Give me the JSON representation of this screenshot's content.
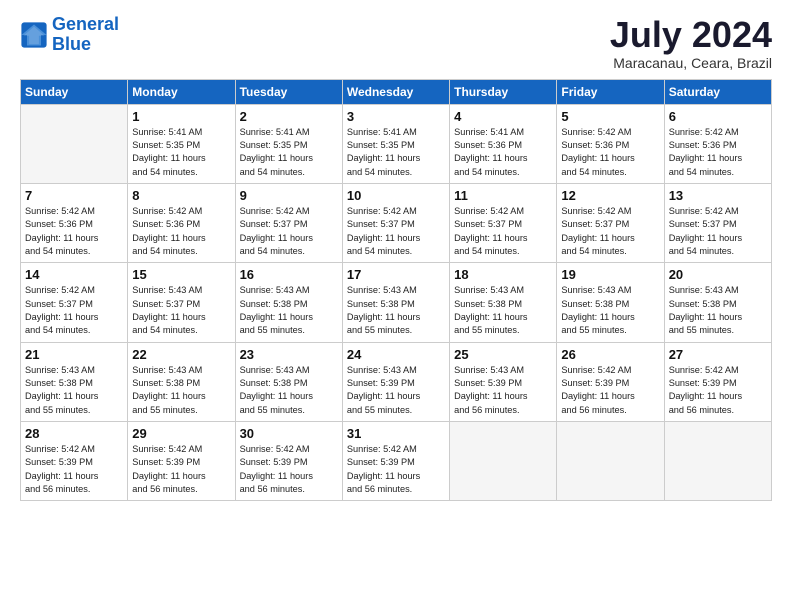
{
  "header": {
    "logo_line1": "General",
    "logo_line2": "Blue",
    "month_year": "July 2024",
    "location": "Maracanau, Ceara, Brazil"
  },
  "weekdays": [
    "Sunday",
    "Monday",
    "Tuesday",
    "Wednesday",
    "Thursday",
    "Friday",
    "Saturday"
  ],
  "weeks": [
    [
      {
        "day": "",
        "info": ""
      },
      {
        "day": "1",
        "info": "Sunrise: 5:41 AM\nSunset: 5:35 PM\nDaylight: 11 hours\nand 54 minutes."
      },
      {
        "day": "2",
        "info": "Sunrise: 5:41 AM\nSunset: 5:35 PM\nDaylight: 11 hours\nand 54 minutes."
      },
      {
        "day": "3",
        "info": "Sunrise: 5:41 AM\nSunset: 5:35 PM\nDaylight: 11 hours\nand 54 minutes."
      },
      {
        "day": "4",
        "info": "Sunrise: 5:41 AM\nSunset: 5:36 PM\nDaylight: 11 hours\nand 54 minutes."
      },
      {
        "day": "5",
        "info": "Sunrise: 5:42 AM\nSunset: 5:36 PM\nDaylight: 11 hours\nand 54 minutes."
      },
      {
        "day": "6",
        "info": "Sunrise: 5:42 AM\nSunset: 5:36 PM\nDaylight: 11 hours\nand 54 minutes."
      }
    ],
    [
      {
        "day": "7",
        "info": "Sunrise: 5:42 AM\nSunset: 5:36 PM\nDaylight: 11 hours\nand 54 minutes."
      },
      {
        "day": "8",
        "info": "Sunrise: 5:42 AM\nSunset: 5:36 PM\nDaylight: 11 hours\nand 54 minutes."
      },
      {
        "day": "9",
        "info": "Sunrise: 5:42 AM\nSunset: 5:37 PM\nDaylight: 11 hours\nand 54 minutes."
      },
      {
        "day": "10",
        "info": "Sunrise: 5:42 AM\nSunset: 5:37 PM\nDaylight: 11 hours\nand 54 minutes."
      },
      {
        "day": "11",
        "info": "Sunrise: 5:42 AM\nSunset: 5:37 PM\nDaylight: 11 hours\nand 54 minutes."
      },
      {
        "day": "12",
        "info": "Sunrise: 5:42 AM\nSunset: 5:37 PM\nDaylight: 11 hours\nand 54 minutes."
      },
      {
        "day": "13",
        "info": "Sunrise: 5:42 AM\nSunset: 5:37 PM\nDaylight: 11 hours\nand 54 minutes."
      }
    ],
    [
      {
        "day": "14",
        "info": "Sunrise: 5:42 AM\nSunset: 5:37 PM\nDaylight: 11 hours\nand 54 minutes."
      },
      {
        "day": "15",
        "info": "Sunrise: 5:43 AM\nSunset: 5:37 PM\nDaylight: 11 hours\nand 54 minutes."
      },
      {
        "day": "16",
        "info": "Sunrise: 5:43 AM\nSunset: 5:38 PM\nDaylight: 11 hours\nand 55 minutes."
      },
      {
        "day": "17",
        "info": "Sunrise: 5:43 AM\nSunset: 5:38 PM\nDaylight: 11 hours\nand 55 minutes."
      },
      {
        "day": "18",
        "info": "Sunrise: 5:43 AM\nSunset: 5:38 PM\nDaylight: 11 hours\nand 55 minutes."
      },
      {
        "day": "19",
        "info": "Sunrise: 5:43 AM\nSunset: 5:38 PM\nDaylight: 11 hours\nand 55 minutes."
      },
      {
        "day": "20",
        "info": "Sunrise: 5:43 AM\nSunset: 5:38 PM\nDaylight: 11 hours\nand 55 minutes."
      }
    ],
    [
      {
        "day": "21",
        "info": "Sunrise: 5:43 AM\nSunset: 5:38 PM\nDaylight: 11 hours\nand 55 minutes."
      },
      {
        "day": "22",
        "info": "Sunrise: 5:43 AM\nSunset: 5:38 PM\nDaylight: 11 hours\nand 55 minutes."
      },
      {
        "day": "23",
        "info": "Sunrise: 5:43 AM\nSunset: 5:38 PM\nDaylight: 11 hours\nand 55 minutes."
      },
      {
        "day": "24",
        "info": "Sunrise: 5:43 AM\nSunset: 5:39 PM\nDaylight: 11 hours\nand 55 minutes."
      },
      {
        "day": "25",
        "info": "Sunrise: 5:43 AM\nSunset: 5:39 PM\nDaylight: 11 hours\nand 56 minutes."
      },
      {
        "day": "26",
        "info": "Sunrise: 5:42 AM\nSunset: 5:39 PM\nDaylight: 11 hours\nand 56 minutes."
      },
      {
        "day": "27",
        "info": "Sunrise: 5:42 AM\nSunset: 5:39 PM\nDaylight: 11 hours\nand 56 minutes."
      }
    ],
    [
      {
        "day": "28",
        "info": "Sunrise: 5:42 AM\nSunset: 5:39 PM\nDaylight: 11 hours\nand 56 minutes."
      },
      {
        "day": "29",
        "info": "Sunrise: 5:42 AM\nSunset: 5:39 PM\nDaylight: 11 hours\nand 56 minutes."
      },
      {
        "day": "30",
        "info": "Sunrise: 5:42 AM\nSunset: 5:39 PM\nDaylight: 11 hours\nand 56 minutes."
      },
      {
        "day": "31",
        "info": "Sunrise: 5:42 AM\nSunset: 5:39 PM\nDaylight: 11 hours\nand 56 minutes."
      },
      {
        "day": "",
        "info": ""
      },
      {
        "day": "",
        "info": ""
      },
      {
        "day": "",
        "info": ""
      }
    ]
  ]
}
